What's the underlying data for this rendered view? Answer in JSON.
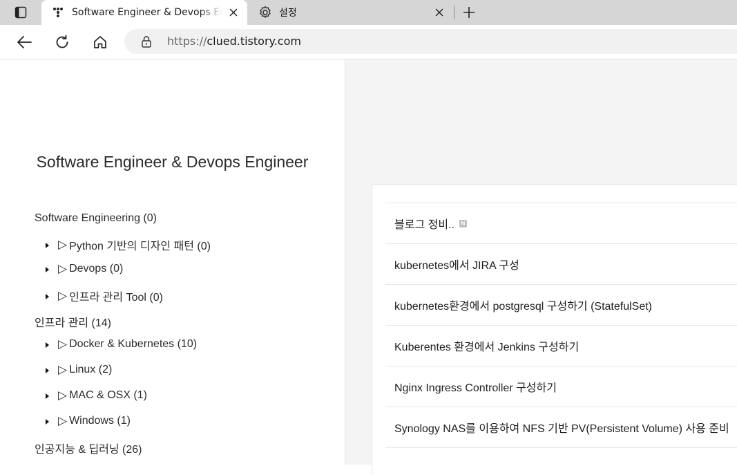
{
  "tabs": [
    {
      "title": "Software Engineer & Devops Engineer",
      "favicon": "tistory-icon",
      "active": true
    },
    {
      "title": "설정",
      "favicon": "gear-icon",
      "active": false
    }
  ],
  "address_bar": {
    "protocol": "https://",
    "host": "clued.tistory.com"
  },
  "blog": {
    "title": "Software Engineer & Devops Engineer"
  },
  "categories": [
    {
      "label": "Software Engineering (0)",
      "level": 0
    },
    {
      "label": "Python 기반의 디자인 패턴 (0)",
      "level": 1
    },
    {
      "label": "Devops (0)",
      "level": 1
    },
    {
      "label": "인프라 관리 Tool (0)",
      "level": 1
    },
    {
      "label": "인프라 관리 (14)",
      "level": 0
    },
    {
      "label": "Docker & Kubernetes (10)",
      "level": 1
    },
    {
      "label": "Linux (2)",
      "level": 1
    },
    {
      "label": "MAC & OSX (1)",
      "level": 1
    },
    {
      "label": "Windows (1)",
      "level": 1
    },
    {
      "label": "인공지능 & 딥러닝 (26)",
      "level": 0
    }
  ],
  "sub_marker": "▷",
  "posts": [
    {
      "title": "블로그 정비..",
      "new": true
    },
    {
      "title": "kubernetes에서 JIRA 구성",
      "new": false
    },
    {
      "title": "kubernetes환경에서 postgresql 구성하기 (StatefulSet)",
      "new": false
    },
    {
      "title": "Kuberentes 환경에서 Jenkins 구성하기",
      "new": false
    },
    {
      "title": "Nginx Ingress Controller 구성하기",
      "new": false
    },
    {
      "title": "Synology NAS를 이용하여 NFS 기반 PV(Persistent Volume) 사용 준비",
      "new": false
    }
  ],
  "new_badge_text": "N"
}
